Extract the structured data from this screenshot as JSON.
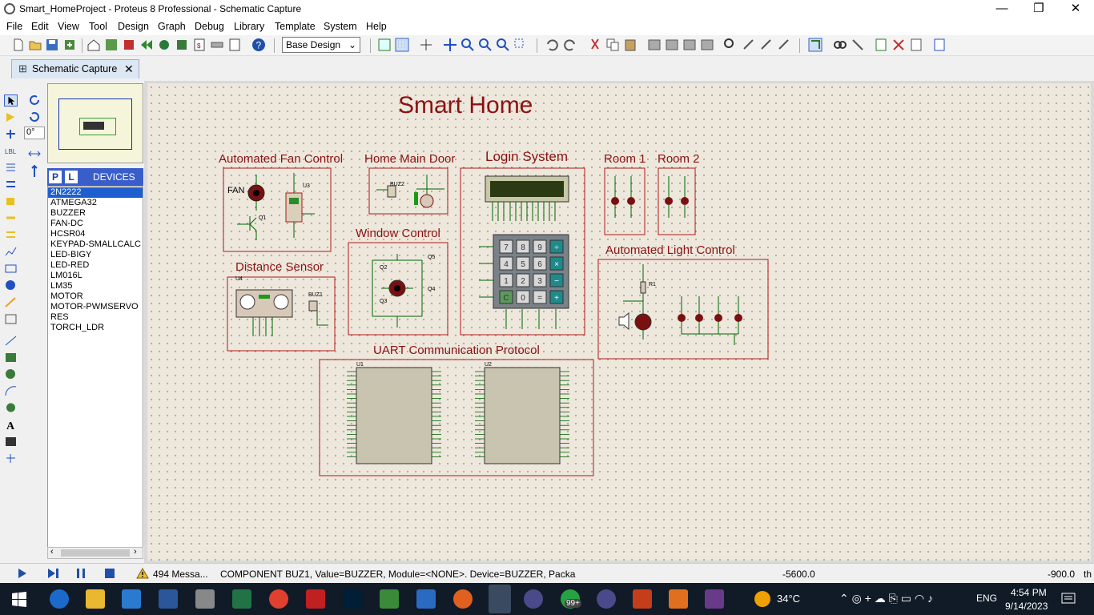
{
  "window": {
    "title": "Smart_HomeProject - Proteus 8 Professional - Schematic Capture",
    "min": "—",
    "max": "❐",
    "close": "✕"
  },
  "menu": [
    "File",
    "Edit",
    "View",
    "Tool",
    "Design",
    "Graph",
    "Debug",
    "Library",
    "Template",
    "System",
    "Help"
  ],
  "toolbar": {
    "design_select": "Base Design"
  },
  "tab": {
    "label": "Schematic Capture",
    "close": "✕"
  },
  "rotation": "0°",
  "devices": {
    "p": "P",
    "l": "L",
    "header": "DEVICES",
    "items": [
      "2N2222",
      "ATMEGA32",
      "BUZZER",
      "FAN-DC",
      "HCSR04",
      "KEYPAD-SMALLCALC",
      "LED-BIGY",
      "LED-RED",
      "LM016L",
      "LM35",
      "MOTOR",
      "MOTOR-PWMSERVO",
      "RES",
      "TORCH_LDR"
    ],
    "selected": 0
  },
  "schematic": {
    "title": "Smart Home",
    "blocks": {
      "fan": "Automated Fan Control",
      "door": "Home Main Door",
      "login": "Login System",
      "room1": "Room 1",
      "room2": "Room 2",
      "window": "Window Control",
      "distance": "Distance Sensor",
      "light": "Automated Light Control",
      "uart": "UART Communication Protocol"
    },
    "labels": {
      "fan": "FAN",
      "u3": "U3",
      "q1": "Q1",
      "buz2": "BUZ2",
      "buz1": "BUZ1",
      "u4": "U4",
      "q2": "Q2",
      "q3": "Q3",
      "q4": "Q4",
      "q5": "Q5",
      "r1": "R1",
      "u1": "U1",
      "u2": "U2"
    },
    "keypad": [
      "7",
      "8",
      "9",
      "÷",
      "4",
      "5",
      "6",
      "×",
      "1",
      "2",
      "3",
      "−",
      "C",
      "0",
      "=",
      "+"
    ]
  },
  "status": {
    "messages": "494 Messa...",
    "component": "COMPONENT BUZ1, Value=BUZZER, Module=<NONE>. Device=BUZZER, Packa",
    "x": "-5600.0",
    "y": "-900.0",
    "unit": "th"
  },
  "taskbar": {
    "weather": "34°C",
    "lang": "ENG",
    "time": "4:54 PM",
    "date": "9/14/2023",
    "badge": "99+"
  },
  "colors": {
    "accent": "#3a5ec9",
    "wire": "#006400",
    "border": "#b01818",
    "title": "#8b1212"
  }
}
